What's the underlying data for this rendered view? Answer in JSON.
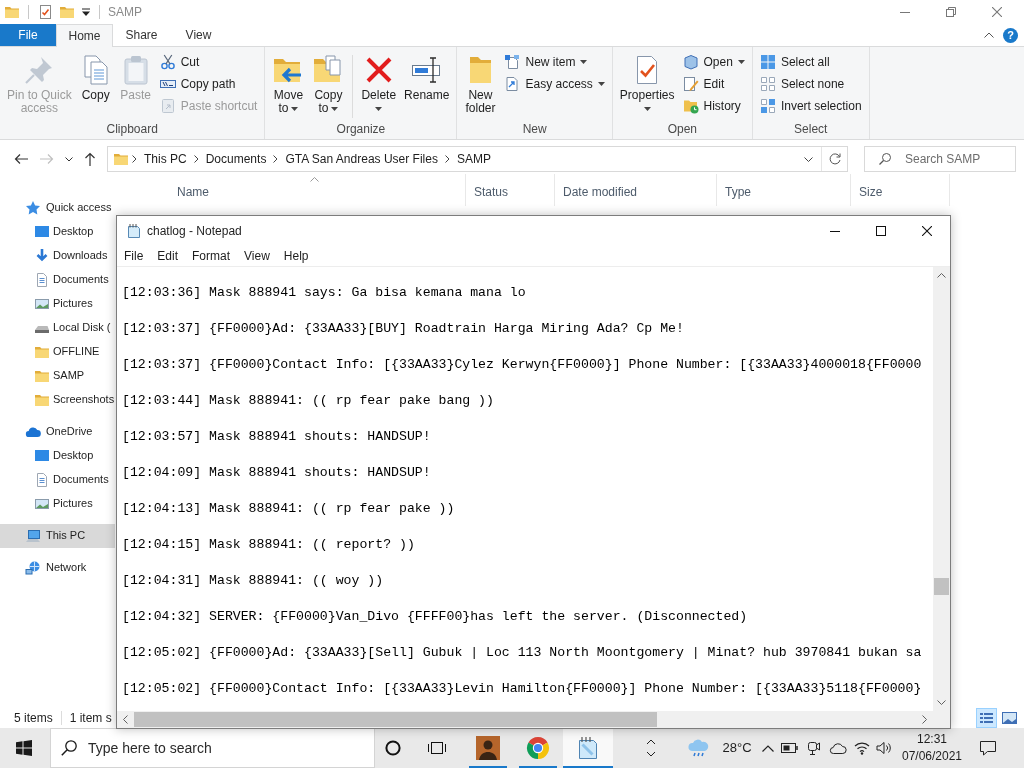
{
  "explorer": {
    "title": "SAMP",
    "file_tab": "File",
    "ribbon_tabs": [
      {
        "label": "Home",
        "selected": true
      },
      {
        "label": "Share",
        "selected": false
      },
      {
        "label": "View",
        "selected": false
      }
    ],
    "help_button": "?",
    "ribbon_groups": [
      {
        "label": "Clipboard",
        "large": [
          {
            "label": "Pin to Quick access",
            "kind": "pin",
            "dropdown": false,
            "disabled": true
          },
          {
            "label": "Copy",
            "kind": "copy",
            "dropdown": false,
            "disabled": false
          },
          {
            "label": "Paste",
            "kind": "paste",
            "dropdown": false,
            "disabled": true
          }
        ],
        "small": [
          {
            "label": "Cut",
            "kind": "cut",
            "dropdown": false,
            "disabled": false
          },
          {
            "label": "Copy path",
            "kind": "path",
            "dropdown": false,
            "disabled": false
          },
          {
            "label": "Paste shortcut",
            "kind": "shortcut",
            "dropdown": false,
            "disabled": true
          }
        ]
      },
      {
        "label": "Organize",
        "large": [
          {
            "label": "Move to",
            "kind": "move",
            "dropdown": true,
            "disabled": false,
            "divider_before": false
          },
          {
            "label": "Copy to",
            "kind": "copyto",
            "dropdown": true,
            "disabled": false,
            "divider_before": false
          },
          {
            "label": "Delete",
            "kind": "delete",
            "dropdown": true,
            "disabled": false,
            "divider_before": true
          },
          {
            "label": "Rename",
            "kind": "rename",
            "dropdown": false,
            "disabled": false,
            "divider_before": false
          }
        ]
      },
      {
        "label": "New",
        "large": [
          {
            "label": "New folder",
            "kind": "folder",
            "dropdown": false,
            "disabled": false
          }
        ],
        "small": [
          {
            "label": "New item",
            "kind": "newitem",
            "dropdown": true,
            "disabled": false
          },
          {
            "label": "Easy access",
            "kind": "access",
            "dropdown": true,
            "disabled": false
          }
        ]
      },
      {
        "label": "Open",
        "large": [
          {
            "label": "Properties",
            "kind": "properties",
            "dropdown": true,
            "disabled": false
          }
        ],
        "small": [
          {
            "label": "Open",
            "kind": "open",
            "dropdown": true,
            "disabled": false
          },
          {
            "label": "Edit",
            "kind": "edit",
            "dropdown": false,
            "disabled": false
          },
          {
            "label": "History",
            "kind": "history",
            "dropdown": false,
            "disabled": false
          }
        ]
      },
      {
        "label": "Select",
        "small": [
          {
            "label": "Select all",
            "kind": "selectall",
            "dropdown": false,
            "disabled": false
          },
          {
            "label": "Select none",
            "kind": "selectnone",
            "dropdown": false,
            "disabled": false
          },
          {
            "label": "Invert selection",
            "kind": "invert",
            "dropdown": false,
            "disabled": false
          }
        ]
      }
    ],
    "nav_buttons": [
      {
        "kind": "back",
        "disabled": false
      },
      {
        "kind": "forward",
        "disabled": true
      },
      {
        "kind": "recent",
        "disabled": false
      },
      {
        "kind": "up",
        "disabled": false
      }
    ],
    "address": {
      "breadcrumbs": [
        "This PC",
        "Documents",
        "GTA San Andreas User Files",
        "SAMP"
      ],
      "search_placeholder": "Search SAMP"
    },
    "columns": [
      {
        "label": "Name",
        "sorted": true
      },
      {
        "label": "Status",
        "sorted": false
      },
      {
        "label": "Date modified",
        "sorted": false
      },
      {
        "label": "Type",
        "sorted": false
      },
      {
        "label": "Size",
        "sorted": false
      }
    ],
    "sidebar": [
      {
        "label": "Quick access",
        "kind": "star",
        "selected": false,
        "children": [
          {
            "label": "Desktop",
            "kind": "desktop",
            "selected": false
          },
          {
            "label": "Downloads",
            "kind": "download",
            "selected": false
          },
          {
            "label": "Documents",
            "kind": "document",
            "selected": false
          },
          {
            "label": "Pictures",
            "kind": "picture",
            "selected": false
          },
          {
            "label": "Local Disk (",
            "kind": "drive",
            "selected": false
          },
          {
            "label": "OFFLINE",
            "kind": "folder",
            "selected": false
          },
          {
            "label": "SAMP",
            "kind": "folder",
            "selected": false
          },
          {
            "label": "Screenshots",
            "kind": "folder",
            "selected": false
          }
        ]
      },
      {
        "label": "OneDrive",
        "kind": "cloud",
        "selected": false,
        "children": [
          {
            "label": "Desktop",
            "kind": "desktop",
            "selected": false
          },
          {
            "label": "Documents",
            "kind": "document",
            "selected": false
          },
          {
            "label": "Pictures",
            "kind": "picture",
            "selected": false
          }
        ]
      },
      {
        "label": "This PC",
        "kind": "pc",
        "selected": true
      },
      {
        "label": "Network",
        "kind": "network",
        "selected": false
      }
    ],
    "status_bar": {
      "item_count": "5 items",
      "selection": "1 item s",
      "views": [
        {
          "kind": "details",
          "selected": true
        },
        {
          "kind": "tiles",
          "selected": false
        }
      ]
    }
  },
  "notepad": {
    "title": "chatlog - Notepad",
    "menu": [
      "File",
      "Edit",
      "Format",
      "View",
      "Help"
    ],
    "lines": [
      "[12:03:36] Mask 888941 says: Ga bisa kemana mana lo",
      "[12:03:37] {FF0000}Ad: {33AA33}[BUY] Roadtrain Harga Miring Ada? Cp Me!",
      "[12:03:37] {FF0000}Contact Info: [{33AA33}Cylez Kerwyn{FF0000}] Phone Number: [{33AA33}4000018{FF0000",
      "[12:03:44] Mask 888941: (( rp fear pake bang ))",
      "[12:03:57] Mask 888941 shouts: HANDSUP!",
      "[12:04:09] Mask 888941 shouts: HANDSUP!",
      "[12:04:13] Mask 888941: (( rp fear pake ))",
      "[12:04:15] Mask 888941: (( report? ))",
      "[12:04:31] Mask 888941: (( woy ))",
      "[12:04:32] SERVER: {FF0000}Van_Divo {FFFF00}has left the server. (Disconnected)",
      "[12:05:02] {FF0000}Ad: {33AA33}[Sell] Gubuk | Loc 113 North Moontgomery | Minat? hub 3970841 bukan sa",
      "[12:05:02] {FF0000}Contact Info: [{33AA33}Levin Hamilton{FF0000}] Phone Number: [{33AA33}5118{FF0000}"
    ]
  },
  "taskbar": {
    "search_placeholder": "Type here to search",
    "apps": [
      {
        "kind": "game",
        "running": true,
        "selected": false
      },
      {
        "kind": "browser",
        "running": true,
        "selected": false
      },
      {
        "kind": "notepad",
        "running": true,
        "selected": true
      }
    ],
    "temperature": "28°C",
    "time": "12:31",
    "date": "07/06/2021"
  }
}
